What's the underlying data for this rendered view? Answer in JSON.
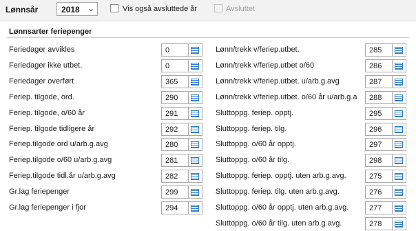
{
  "header": {
    "year_label": "Lønnsår",
    "year_value": "2018",
    "show_closed_label": "Vis også avsluttede år",
    "closed_label": "Avsluttet"
  },
  "section": {
    "title": "Lønnsarter feriepenger"
  },
  "icons": {
    "dropdown": "chevron-down-icon",
    "row_button": "list-icon"
  },
  "colors": {
    "accent": "#2f7fd1",
    "topbar_bg": "#f2f2f2"
  },
  "left": [
    {
      "label": "Feriedager avvikles",
      "value": "0"
    },
    {
      "label": "Feriedager ikke utbet.",
      "value": "0"
    },
    {
      "label": "Feriedager overført",
      "value": "365"
    },
    {
      "label": "Feriep. tilgode, ord.",
      "value": "290"
    },
    {
      "label": "Feriep. tilgode, o/60 år",
      "value": "291"
    },
    {
      "label": "Feriep. tilgode tidligere år",
      "value": "292"
    },
    {
      "label": "Feriep.tilgode ord u/arb.g.avg",
      "value": "280"
    },
    {
      "label": "Feriep.tilgode o/60 u/arb.g.avg",
      "value": "281"
    },
    {
      "label": "Feriep.tilgode tidl.år u/arb.g.avg",
      "value": "282"
    },
    {
      "label": "Gr.lag feriepenger",
      "value": "299"
    },
    {
      "label": "Gr.lag feriepenger i fjor",
      "value": "294"
    }
  ],
  "right": [
    {
      "label": "Lønn/trekk v/feriep.utbet.",
      "value": "285"
    },
    {
      "label": "Lønn/trekk v/feriep.utbet o/60",
      "value": "286"
    },
    {
      "label": "Lønn/trekk v/feriep.utbet. u/arb.g.avg",
      "value": "287"
    },
    {
      "label": "Lønn/trekk v/feriep.utbet. o/60 år u/arb.g.a",
      "value": "288"
    },
    {
      "label": "Sluttoppg. feriep. opptj.",
      "value": "295"
    },
    {
      "label": "Sluttoppg. feriep. tilg.",
      "value": "296"
    },
    {
      "label": "Sluttoppg. o/60 år opptj.",
      "value": "297"
    },
    {
      "label": "Sluttoppg. o/60 år tilg.",
      "value": "298"
    },
    {
      "label": "Sluttoppg. feriep. opptj. uten arb.g.avg.",
      "value": "275"
    },
    {
      "label": "Sluttoppg. feriep. tilg. uten arb.g.avg.",
      "value": "276"
    },
    {
      "label": "Sluttoppg. o/60 år opptj. uten arb.g.avg.",
      "value": "277"
    },
    {
      "label": "Sluttoppg. o/60 år tilg. uten arb.g.avg.",
      "value": "278"
    }
  ]
}
